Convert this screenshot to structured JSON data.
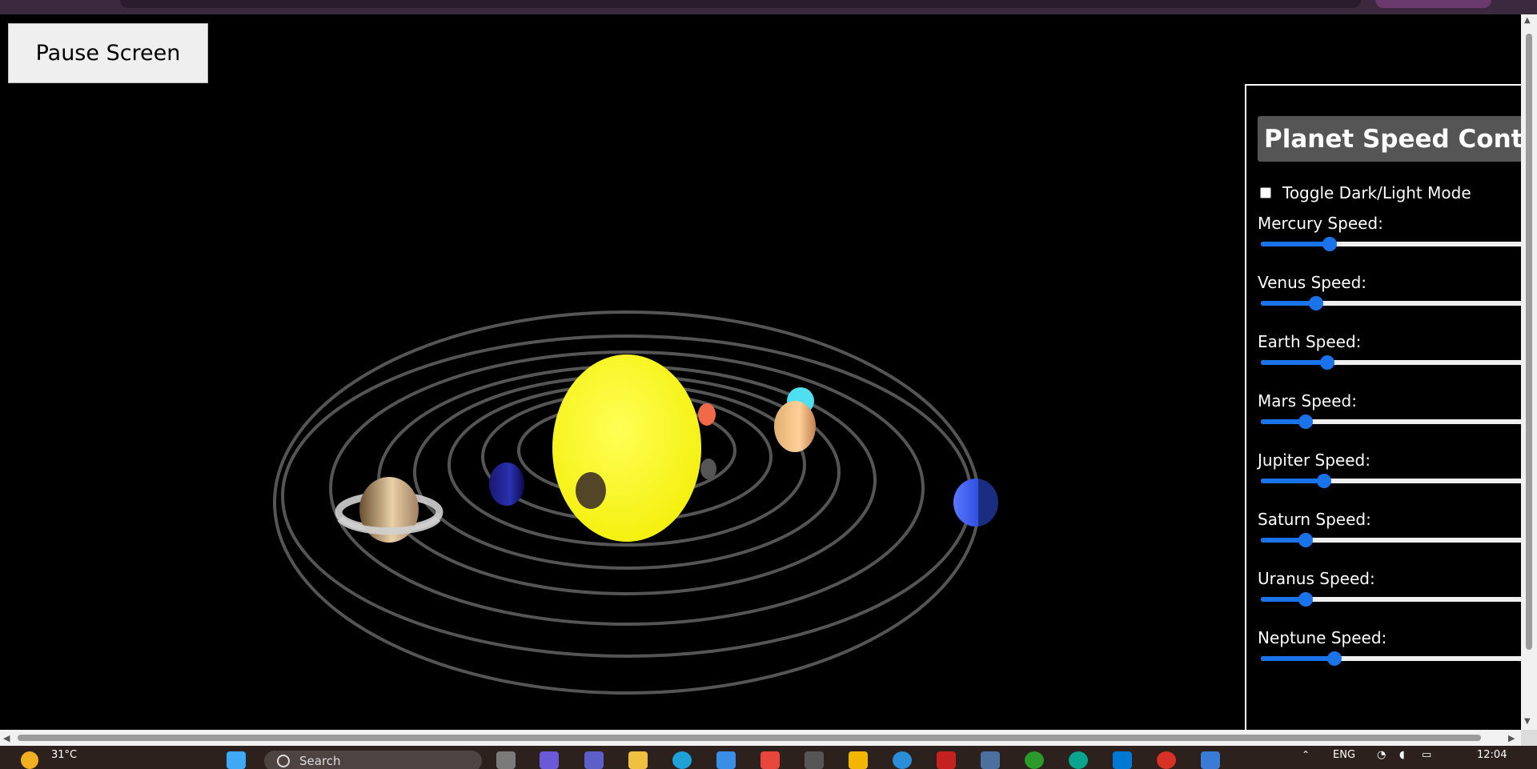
{
  "pause_button": {
    "label": "Pause Screen"
  },
  "panel": {
    "title": "Planet Speed Control",
    "toggle_label": "Toggle Dark/Light Mode",
    "toggle_checked": false,
    "sliders": [
      {
        "label": "Mercury Speed:",
        "value": 0.26
      },
      {
        "label": "Venus Speed:",
        "value": 0.21
      },
      {
        "label": "Earth Speed:",
        "value": 0.25
      },
      {
        "label": "Mars Speed:",
        "value": 0.17
      },
      {
        "label": "Jupiter Speed:",
        "value": 0.24
      },
      {
        "label": "Saturn Speed:",
        "value": 0.17
      },
      {
        "label": "Uranus Speed:",
        "value": 0.17
      },
      {
        "label": "Neptune Speed:",
        "value": 0.28
      }
    ]
  },
  "taskbar": {
    "weather": "31°C",
    "search_placeholder": "Search",
    "language": "ENG",
    "time": "12:04"
  },
  "colors": {
    "sun": "#ffff22",
    "orbit": "#555555",
    "slider_accent": "#1a73e8",
    "panel_title_bg": "#555555"
  }
}
